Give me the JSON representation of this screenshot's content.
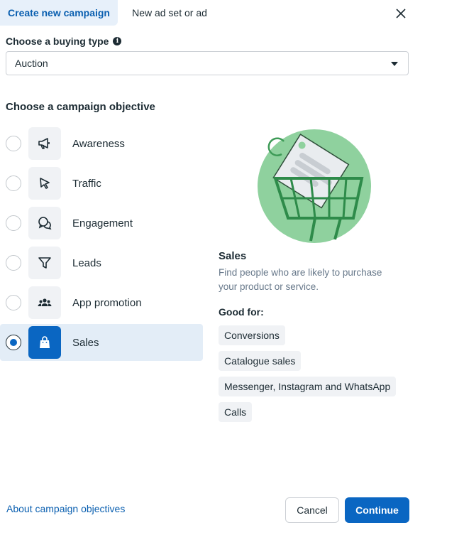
{
  "tabs": {
    "active": "Create new campaign",
    "inactive": "New ad set or ad"
  },
  "buying_type": {
    "label": "Choose a buying type",
    "value": "Auction"
  },
  "objective_heading": "Choose a campaign objective",
  "objectives": [
    {
      "label": "Awareness",
      "icon": "megaphone-icon",
      "selected": false
    },
    {
      "label": "Traffic",
      "icon": "cursor-icon",
      "selected": false
    },
    {
      "label": "Engagement",
      "icon": "chat-bubbles-icon",
      "selected": false
    },
    {
      "label": "Leads",
      "icon": "funnel-icon",
      "selected": false
    },
    {
      "label": "App promotion",
      "icon": "people-icon",
      "selected": false
    },
    {
      "label": "Sales",
      "icon": "shopping-bag-icon",
      "selected": true
    }
  ],
  "detail": {
    "title": "Sales",
    "description": "Find people who are likely to purchase your product or service.",
    "good_for_label": "Good for:",
    "good_for": [
      "Conversions",
      "Catalogue sales",
      "Messenger, Instagram and WhatsApp",
      "Calls"
    ]
  },
  "footer": {
    "link": "About campaign objectives",
    "cancel": "Cancel",
    "continue": "Continue"
  },
  "colors": {
    "accent": "#0a66c2",
    "selected_bg": "#e3edf7",
    "illustration_green": "#8fd19e"
  }
}
